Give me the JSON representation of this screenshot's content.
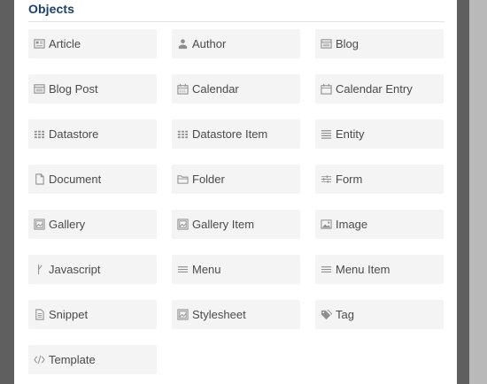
{
  "section": {
    "title": "Objects"
  },
  "items": [
    {
      "label": "Article",
      "icon": "article-icon"
    },
    {
      "label": "Author",
      "icon": "author-icon"
    },
    {
      "label": "Blog",
      "icon": "blog-icon"
    },
    {
      "label": "Blog Post",
      "icon": "blog-post-icon"
    },
    {
      "label": "Calendar",
      "icon": "calendar-icon"
    },
    {
      "label": "Calendar Entry",
      "icon": "calendar-entry-icon"
    },
    {
      "label": "Datastore",
      "icon": "datastore-icon"
    },
    {
      "label": "Datastore Item",
      "icon": "datastore-item-icon"
    },
    {
      "label": "Entity",
      "icon": "entity-icon"
    },
    {
      "label": "Document",
      "icon": "document-icon"
    },
    {
      "label": "Folder",
      "icon": "folder-icon"
    },
    {
      "label": "Form",
      "icon": "form-icon"
    },
    {
      "label": "Gallery",
      "icon": "gallery-icon"
    },
    {
      "label": "Gallery Item",
      "icon": "gallery-item-icon"
    },
    {
      "label": "Image",
      "icon": "image-icon"
    },
    {
      "label": "Javascript",
      "icon": "javascript-icon"
    },
    {
      "label": "Menu",
      "icon": "menu-icon"
    },
    {
      "label": "Menu Item",
      "icon": "menu-item-icon"
    },
    {
      "label": "Snippet",
      "icon": "snippet-icon"
    },
    {
      "label": "Stylesheet",
      "icon": "stylesheet-icon"
    },
    {
      "label": "Tag",
      "icon": "tag-icon"
    },
    {
      "label": "Template",
      "icon": "template-icon"
    }
  ],
  "colors": {
    "title": "#1b3f6e",
    "tile_bg": "#f4f4f4",
    "text": "#4a4a4a",
    "icon": "#8e8e8e"
  }
}
